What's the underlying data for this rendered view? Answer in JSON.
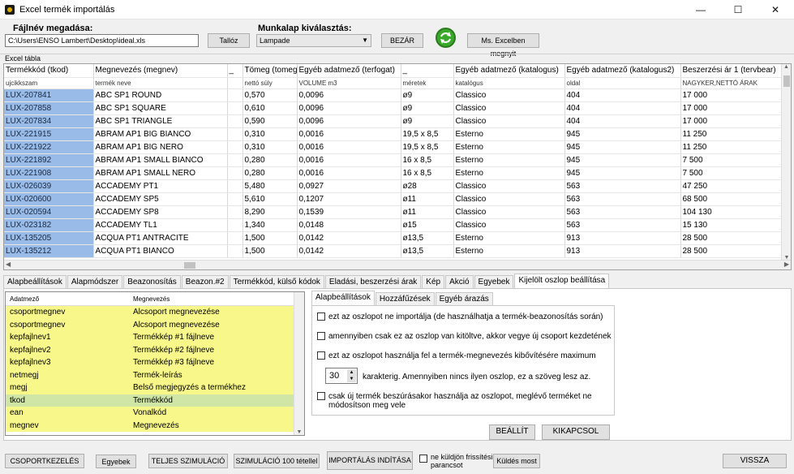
{
  "window": {
    "title": "Excel termék importálás",
    "minimize": "—",
    "maximize": "☐",
    "close": "✕"
  },
  "file": {
    "label": "Fájlnév megadása:",
    "value": "C:\\Users\\ENSO Lambert\\Desktop\\ideal.xls",
    "browse": "Tallóz"
  },
  "sheet": {
    "label": "Munkalap kiválasztás:",
    "selected": "Lampade",
    "close_btn": "BEZÁR",
    "open_excel": "Ms. Excelben megnyit"
  },
  "grid": {
    "group_label": "Excel tábla",
    "columns": [
      "Termékkód (tkod)",
      "Megnevezés (megnev)",
      "_",
      "Tömeg (tomeg)",
      "Egyéb adatmező (terfogat)",
      "_",
      "Egyéb adatmező (katalogus)",
      "Egyéb adatmező (katalogus2)",
      "Beszerzési ár 1 (tervbear)"
    ],
    "subheaders": [
      "ujcikkszam",
      "termék neve",
      "",
      "nettó súly",
      "VOLUME m3",
      "méretek",
      "katalógus",
      "oldal",
      "NAGYKER,NETTÓ ÁRAK"
    ],
    "rows": [
      [
        "LUX-207841",
        "ABC SP1 ROUND",
        "",
        "0,570",
        "0,0096",
        "ø9",
        "Classico",
        "404",
        "17 000"
      ],
      [
        "LUX-207858",
        "ABC SP1 SQUARE",
        "",
        "0,610",
        "0,0096",
        "ø9",
        "Classico",
        "404",
        "17 000"
      ],
      [
        "LUX-207834",
        "ABC SP1 TRIANGLE",
        "",
        "0,590",
        "0,0096",
        "ø9",
        "Classico",
        "404",
        "17 000"
      ],
      [
        "LUX-221915",
        "ABRAM AP1 BIG BIANCO",
        "",
        "0,310",
        "0,0016",
        "19,5 x 8,5",
        "Esterno",
        "945",
        "11 250"
      ],
      [
        "LUX-221922",
        "ABRAM AP1 BIG NERO",
        "",
        "0,310",
        "0,0016",
        "19,5 x 8,5",
        "Esterno",
        "945",
        "11 250"
      ],
      [
        "LUX-221892",
        "ABRAM AP1 SMALL BIANCO",
        "",
        "0,280",
        "0,0016",
        "16 x 8,5",
        "Esterno",
        "945",
        "7 500"
      ],
      [
        "LUX-221908",
        "ABRAM AP1 SMALL NERO",
        "",
        "0,280",
        "0,0016",
        "16 x 8,5",
        "Esterno",
        "945",
        "7 500"
      ],
      [
        "LUX-026039",
        "ACCADEMY PT1",
        "",
        "5,480",
        "0,0927",
        "ø28",
        "Classico",
        "563",
        "47 250"
      ],
      [
        "LUX-020600",
        "ACCADEMY SP5",
        "",
        "5,610",
        "0,1207",
        "ø11",
        "Classico",
        "563",
        "68 500"
      ],
      [
        "LUX-020594",
        "ACCADEMY SP8",
        "",
        "8,290",
        "0,1539",
        "ø11",
        "Classico",
        "563",
        "104 130"
      ],
      [
        "LUX-023182",
        "ACCADEMY TL1",
        "",
        "1,340",
        "0,0148",
        "ø15",
        "Classico",
        "563",
        "15 130"
      ],
      [
        "LUX-135205",
        "ACQUA PT1 ANTRACITE",
        "",
        "1,500",
        "0,0142",
        "ø13,5",
        "Esterno",
        "913",
        "28 500"
      ],
      [
        "LUX-135212",
        "ACQUA PT1 BIANCO",
        "",
        "1,500",
        "0,0142",
        "ø13,5",
        "Esterno",
        "913",
        "28 500"
      ]
    ]
  },
  "main_tabs": [
    "Alapbeállítások",
    "Alapmódszer",
    "Beazonosítás",
    "Beazon.#2",
    "Termékkód, külső kódok",
    "Eladási, beszerzési árak",
    "Kép",
    "Akció",
    "Egyebek",
    "Kijelölt oszlop beállítása"
  ],
  "field_list": {
    "headers": [
      "Adatmező",
      "Megnevezés"
    ],
    "rows": [
      [
        "csoportmegnev",
        "Alcsoport megnevezése"
      ],
      [
        "csoportmegnev",
        "Alcsoport megnevezése"
      ],
      [
        "kepfajlnev1",
        "Termékkép #1 fájlneve"
      ],
      [
        "kepfajlnev2",
        "Termékkép #2 fájlneve"
      ],
      [
        "kepfajlnev3",
        "Termékkép #3 fájlneve"
      ],
      [
        "netmegj",
        "Termék-leírás"
      ],
      [
        "megj",
        "Belső megjegyzés a termékhez"
      ],
      [
        "tkod",
        "Termékkód"
      ],
      [
        "ean",
        "Vonalkód"
      ],
      [
        "megnev",
        "Megnevezés"
      ]
    ]
  },
  "sub_tabs": [
    "Alapbeállítások",
    "Hozzáfűzések",
    "Egyéb árazás"
  ],
  "options": {
    "opt1": "ezt az oszlopot ne importálja (de használhatja a termék-beazonosítás során)",
    "opt2": "amennyiben csak ez az oszlop van kitöltve, akkor vegye új csoport kezdetének",
    "opt3": "ezt az oszlopot használja fel a termék-megnevezés kibővítésére maximum",
    "chars_value": "30",
    "chars_text": "karakterig. Amennyiben nincs ilyen oszlop, ez a szöveg lesz az.",
    "opt4_line1": "csak új termék beszúrásakor használja az oszlopot, meglévő terméket ne",
    "opt4_line2": "módosítson meg vele"
  },
  "set_btn": "BEÁLLÍT",
  "unset_btn": "KIKAPCSOL",
  "bottom": {
    "group": "CSOPORTKEZELÉS",
    "other": "Egyebek",
    "full_sim": "TELJES SZIMULÁCIÓ",
    "sim100": "SZIMULÁCIÓ 100 tétellel",
    "start": "IMPORTÁLÁS INDÍTÁSA",
    "no_refresh_line1": "ne küldjön frissítési",
    "no_refresh_line2": "parancsot",
    "send_now": "Küldés most",
    "back": "VISSZA"
  }
}
